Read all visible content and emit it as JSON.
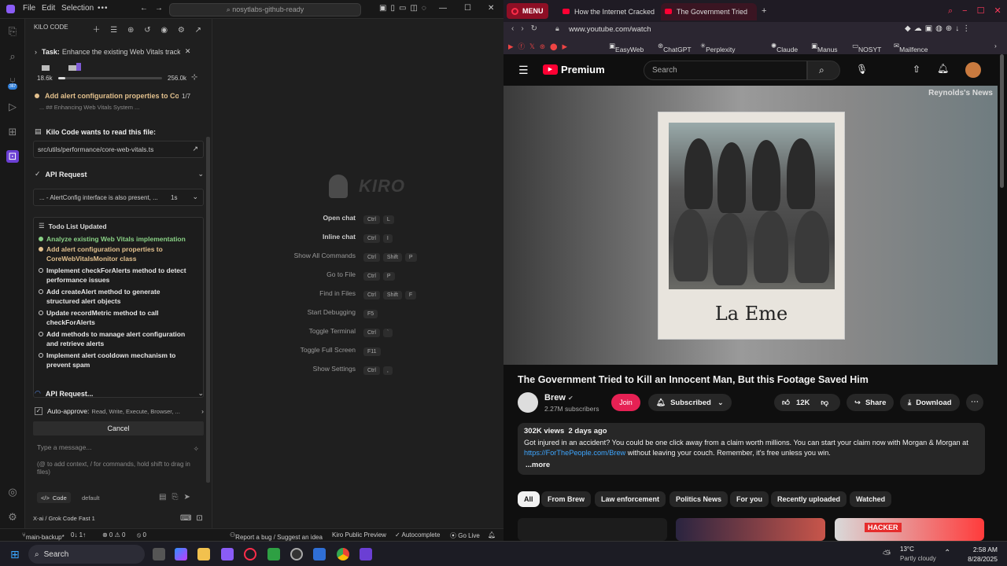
{
  "ide": {
    "menu": [
      "File",
      "Edit",
      "Selection"
    ],
    "search_text": "nosytlabs-github-ready",
    "panel_title": "KILO CODE",
    "task_label": "Task:",
    "task_text": "Enhance the existing Web Vitals tracki...",
    "context_used": "18.6k",
    "context_max": "256.0k",
    "context_fraction": 0.07,
    "current_todo": "Add alert configuration properties to Cor...",
    "current_todo_count": "1/7",
    "scrolled_line": "... ## Enhancing Web Vitals System  ...",
    "read_file_title": "Kilo Code wants to read this file:",
    "read_file_path": "src/utils/performance/core-web-vitals.ts",
    "api_request_label": "API Request",
    "api_request_line": "... - AlertConfig interface is also present, ...",
    "api_request_time": "1s",
    "todo_title": "Todo List Updated",
    "todos": [
      {
        "text": "Analyze existing Web Vitals implementation",
        "status": "done"
      },
      {
        "text": "Add alert configuration properties to CoreWebVitalsMonitor class",
        "status": "active"
      },
      {
        "text": "Implement checkForAlerts method to detect performance issues",
        "status": "pending"
      },
      {
        "text": "Add createAlert method to generate structured alert objects",
        "status": "pending"
      },
      {
        "text": "Update recordMetric method to call checkForAlerts",
        "status": "pending"
      },
      {
        "text": "Add methods to manage alert configuration and retrieve alerts",
        "status": "pending"
      },
      {
        "text": "Implement alert cooldown mechanism to prevent spam",
        "status": "pending"
      }
    ],
    "api_request_pending": "API Request...",
    "auto_approve_label": "Auto-approve:",
    "auto_approve_value": "Read, Write, Execute, Browser, ...",
    "cancel_label": "Cancel",
    "message_placeholder": "Type a message...",
    "message_hint": "(@ to add context, / for commands, hold shift to drag in files)",
    "mode_label": "Code",
    "profile_label": "default",
    "model_label": "X-ai / Grok Code Fast 1",
    "kiro_logo": "KIRO",
    "shortcuts": [
      {
        "label": "Open chat",
        "keys": [
          "Ctrl",
          "L"
        ],
        "bold": true
      },
      {
        "label": "Inline chat",
        "keys": [
          "Ctrl",
          "I"
        ],
        "bold": true
      },
      {
        "label": "Show All Commands",
        "keys": [
          "Ctrl",
          "Shift",
          "P"
        ],
        "bold": false
      },
      {
        "label": "Go to File",
        "keys": [
          "Ctrl",
          "P"
        ],
        "bold": false
      },
      {
        "label": "Find in Files",
        "keys": [
          "Ctrl",
          "Shift",
          "F"
        ],
        "bold": false
      },
      {
        "label": "Start Debugging",
        "keys": [
          "F5"
        ],
        "bold": false
      },
      {
        "label": "Toggle Terminal",
        "keys": [
          "Ctrl",
          "`"
        ],
        "bold": false
      },
      {
        "label": "Toggle Full Screen",
        "keys": [
          "F11"
        ],
        "bold": false
      },
      {
        "label": "Show Settings",
        "keys": [
          "Ctrl",
          ","
        ],
        "bold": false
      }
    ],
    "status": {
      "branch": "main-backup*",
      "sync": "0↓ 1↑",
      "problems": "⊗ 0 ⚠ 0",
      "ports": "⦸ 0",
      "report": "Report a bug / Suggest an idea",
      "kiro_preview": "Kiro Public Preview",
      "autocomplete": "✓ Autocomplete",
      "golive": "⦿ Go Live"
    }
  },
  "browser": {
    "menu_label": "MENU",
    "tabs": [
      "How the Internet Cracked",
      "The Government Tried"
    ],
    "url": "www.youtube.com/watch",
    "bookmarks": [
      "EasyWeb",
      "ChatGPT",
      "Perplexity",
      "Claude",
      "Manus",
      "NOSYT",
      "Mailfence"
    ],
    "yt_brand": "Premium",
    "search_placeholder": "Search",
    "video_watermark": "Reynolds's News",
    "photo_caption": "La Eme",
    "video_title": "The Government Tried to Kill an Innocent Man, But this Footage Saved Him",
    "channel_name": "Brew",
    "subscribers": "2.27M subscribers",
    "join_label": "Join",
    "subscribed_label": "Subscribed",
    "likes": "12K",
    "share_label": "Share",
    "download_label": "Download",
    "views_line": "302K views  2 days ago",
    "description": "Got injured in an accident? You could be one click away from a claim worth millions. You can start your claim now with Morgan & Morgan at",
    "description_link": "https://ForThePeople.com/Brew",
    "description_tail": " without leaving your couch. Remember, it's free unless you win.",
    "more_label": "...more",
    "chips": [
      "All",
      "From Brew",
      "Law enforcement",
      "Politics News",
      "For you",
      "Recently uploaded",
      "Watched"
    ],
    "thumb_badge": "HACKER"
  },
  "taskbar": {
    "search_label": "Search",
    "weather_temp": "13°C",
    "weather_desc": "Partly cloudy",
    "time": "2:58 AM",
    "date": "8/28/2025"
  },
  "colors": {
    "yt_red": "#ff0033",
    "todo_done": "#89d185",
    "todo_active": "#e2c08d",
    "accent_purple": "#8a5cf6"
  }
}
